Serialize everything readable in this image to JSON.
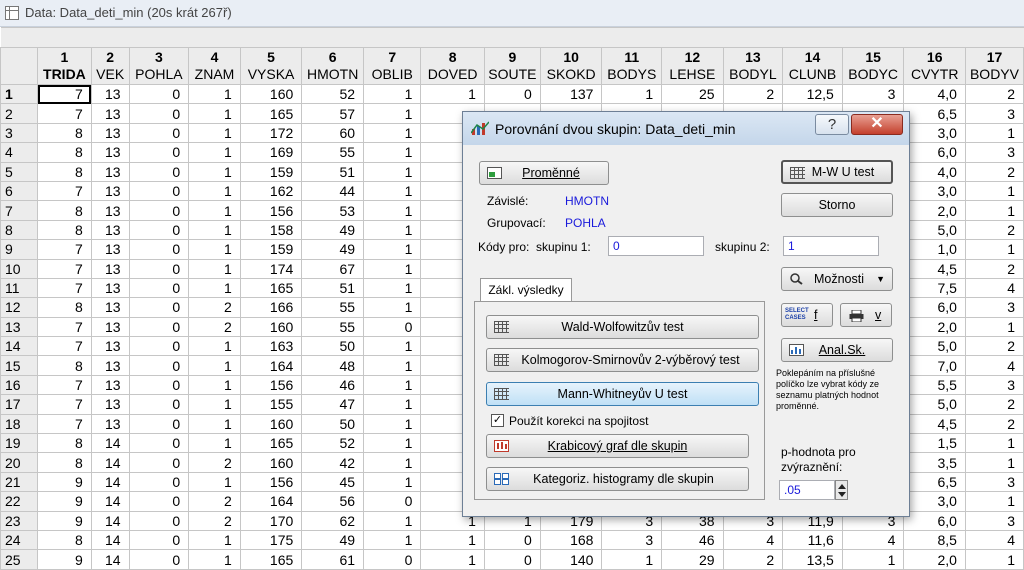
{
  "window": {
    "title": "Data: Data_deti_min (20s krát 267ř)"
  },
  "sheet": {
    "columns": [
      {
        "num": "1",
        "name": "TRIDA"
      },
      {
        "num": "2",
        "name": "VEK"
      },
      {
        "num": "3",
        "name": "POHLA"
      },
      {
        "num": "4",
        "name": "ZNAM"
      },
      {
        "num": "5",
        "name": "VYSKA"
      },
      {
        "num": "6",
        "name": "HMOTN"
      },
      {
        "num": "7",
        "name": "OBLIB"
      },
      {
        "num": "8",
        "name": "DOVED"
      },
      {
        "num": "9",
        "name": "SOUTE"
      },
      {
        "num": "10",
        "name": "SKOKD"
      },
      {
        "num": "11",
        "name": "BODYS"
      },
      {
        "num": "12",
        "name": "LEHSE"
      },
      {
        "num": "13",
        "name": "BODYL"
      },
      {
        "num": "14",
        "name": "CLUNB"
      },
      {
        "num": "15",
        "name": "BODYC"
      },
      {
        "num": "16",
        "name": "CVYTR"
      },
      {
        "num": "17",
        "name": "BODYV"
      }
    ],
    "rows": [
      {
        "id": "1",
        "cells": [
          "7",
          "13",
          "0",
          "1",
          "160",
          "52",
          "1",
          "1",
          "0",
          "137",
          "1",
          "25",
          "2",
          "12,5",
          "3",
          "4,0",
          "2"
        ]
      },
      {
        "id": "2",
        "cells": [
          "7",
          "13",
          "0",
          "1",
          "165",
          "57",
          "1",
          "",
          "",
          "",
          "",
          "",
          "",
          "",
          "",
          "6,5",
          "3"
        ]
      },
      {
        "id": "3",
        "cells": [
          "8",
          "13",
          "0",
          "1",
          "172",
          "60",
          "1",
          "",
          "",
          "",
          "",
          "",
          "",
          "",
          "",
          "3,0",
          "1"
        ]
      },
      {
        "id": "4",
        "cells": [
          "8",
          "13",
          "0",
          "1",
          "169",
          "55",
          "1",
          "",
          "",
          "",
          "",
          "",
          "",
          "",
          "",
          "6,0",
          "3"
        ]
      },
      {
        "id": "5",
        "cells": [
          "8",
          "13",
          "0",
          "1",
          "159",
          "51",
          "1",
          "",
          "",
          "",
          "",
          "",
          "",
          "",
          "",
          "4,0",
          "2"
        ]
      },
      {
        "id": "6",
        "cells": [
          "7",
          "13",
          "0",
          "1",
          "162",
          "44",
          "1",
          "",
          "",
          "",
          "",
          "",
          "",
          "",
          "",
          "3,0",
          "1"
        ]
      },
      {
        "id": "7",
        "cells": [
          "8",
          "13",
          "0",
          "1",
          "156",
          "53",
          "1",
          "",
          "",
          "",
          "",
          "",
          "",
          "",
          "",
          "2,0",
          "1"
        ]
      },
      {
        "id": "8",
        "cells": [
          "8",
          "13",
          "0",
          "1",
          "158",
          "49",
          "1",
          "",
          "",
          "",
          "",
          "",
          "",
          "",
          "",
          "5,0",
          "2"
        ]
      },
      {
        "id": "9",
        "cells": [
          "7",
          "13",
          "0",
          "1",
          "159",
          "49",
          "1",
          "",
          "",
          "",
          "",
          "",
          "",
          "",
          "",
          "1,0",
          "1"
        ]
      },
      {
        "id": "10",
        "cells": [
          "7",
          "13",
          "0",
          "1",
          "174",
          "67",
          "1",
          "",
          "",
          "",
          "",
          "",
          "",
          "",
          "",
          "4,5",
          "2"
        ]
      },
      {
        "id": "11",
        "cells": [
          "7",
          "13",
          "0",
          "1",
          "165",
          "51",
          "1",
          "",
          "",
          "",
          "",
          "",
          "",
          "",
          "",
          "7,5",
          "4"
        ]
      },
      {
        "id": "12",
        "cells": [
          "8",
          "13",
          "0",
          "2",
          "166",
          "55",
          "1",
          "",
          "",
          "",
          "",
          "",
          "",
          "",
          "",
          "6,0",
          "3"
        ]
      },
      {
        "id": "13",
        "cells": [
          "7",
          "13",
          "0",
          "2",
          "160",
          "55",
          "0",
          "",
          "",
          "",
          "",
          "",
          "",
          "",
          "",
          "2,0",
          "1"
        ]
      },
      {
        "id": "14",
        "cells": [
          "7",
          "13",
          "0",
          "1",
          "163",
          "50",
          "1",
          "",
          "",
          "",
          "",
          "",
          "",
          "",
          "",
          "5,0",
          "2"
        ]
      },
      {
        "id": "15",
        "cells": [
          "8",
          "13",
          "0",
          "1",
          "164",
          "48",
          "1",
          "",
          "",
          "",
          "",
          "",
          "",
          "",
          "",
          "7,0",
          "4"
        ]
      },
      {
        "id": "16",
        "cells": [
          "7",
          "13",
          "0",
          "1",
          "156",
          "46",
          "1",
          "",
          "",
          "",
          "",
          "",
          "",
          "",
          "",
          "5,5",
          "3"
        ]
      },
      {
        "id": "17",
        "cells": [
          "7",
          "13",
          "0",
          "1",
          "155",
          "47",
          "1",
          "",
          "",
          "",
          "",
          "",
          "",
          "",
          "",
          "5,0",
          "2"
        ]
      },
      {
        "id": "18",
        "cells": [
          "7",
          "13",
          "0",
          "1",
          "160",
          "50",
          "1",
          "",
          "",
          "",
          "",
          "",
          "",
          "",
          "",
          "4,5",
          "2"
        ]
      },
      {
        "id": "19",
        "cells": [
          "8",
          "14",
          "0",
          "1",
          "165",
          "52",
          "1",
          "",
          "",
          "",
          "",
          "",
          "",
          "",
          "",
          "1,5",
          "1"
        ]
      },
      {
        "id": "20",
        "cells": [
          "8",
          "14",
          "0",
          "2",
          "160",
          "42",
          "1",
          "",
          "",
          "",
          "",
          "",
          "",
          "",
          "",
          "3,5",
          "1"
        ]
      },
      {
        "id": "21",
        "cells": [
          "9",
          "14",
          "0",
          "1",
          "156",
          "45",
          "1",
          "",
          "",
          "",
          "",
          "",
          "",
          "",
          "",
          "6,5",
          "3"
        ]
      },
      {
        "id": "22",
        "cells": [
          "9",
          "14",
          "0",
          "2",
          "164",
          "56",
          "0",
          "",
          "",
          "",
          "",
          "",
          "",
          "",
          "",
          "3,0",
          "1"
        ]
      },
      {
        "id": "23",
        "cells": [
          "9",
          "14",
          "0",
          "2",
          "170",
          "62",
          "1",
          "1",
          "1",
          "179",
          "3",
          "38",
          "3",
          "11,9",
          "3",
          "6,0",
          "3"
        ]
      },
      {
        "id": "24",
        "cells": [
          "8",
          "14",
          "0",
          "1",
          "175",
          "49",
          "1",
          "1",
          "0",
          "168",
          "3",
          "46",
          "4",
          "11,6",
          "4",
          "8,5",
          "4"
        ]
      },
      {
        "id": "25",
        "cells": [
          "9",
          "14",
          "0",
          "1",
          "165",
          "61",
          "0",
          "1",
          "0",
          "140",
          "1",
          "29",
          "2",
          "13,5",
          "1",
          "2,0",
          "1"
        ]
      }
    ]
  },
  "dialog": {
    "title": "Porovnání dvou skupin: Data_deti_min",
    "help_label": "?",
    "close_label": "✕",
    "variables_button": "Proměnné",
    "dependent_label": "Závislé:",
    "dependent_value": "HMOTN",
    "grouping_label": "Grupovací:",
    "grouping_value": "POHLA",
    "codes_label": "Kódy pro:",
    "group1_label": "skupinu 1:",
    "group1_value": "0",
    "group2_label": "skupinu 2:",
    "group2_value": "1",
    "mwu_button": "M-W U test",
    "cancel_button": "Storno",
    "options_button": "Možnosti",
    "tab_label": "Zákl. výsledky",
    "ww_button": "Wald-Wolfowitzův test",
    "ks_button": "Kolmogorov-Smirnovův 2-výběrový test",
    "mw_button": "Mann-Whitneyův U test",
    "continuity_label": "Použít korekci na spojitost",
    "continuity_checked": true,
    "boxplot_button": "Krabicový graf dle skupin",
    "histogram_button": "Kategoriz. histogramy dle skupin",
    "select_cases_icon_text": "SELECT CASES",
    "select_f_label": "f",
    "print_v_label": "v",
    "anal_button": "Anal.Sk.",
    "note_text": "Poklepáním na příslušné políčko lze vybrat kódy ze seznamu platných hodnot proměnné.",
    "pvalue_label": "p-hodnota pro zvýraznění:",
    "pvalue_value": ".05"
  },
  "colors": {
    "accent_blue": "#1a1adb",
    "close_red": "#c4402d",
    "highlight_button": "#bfe0f6"
  }
}
